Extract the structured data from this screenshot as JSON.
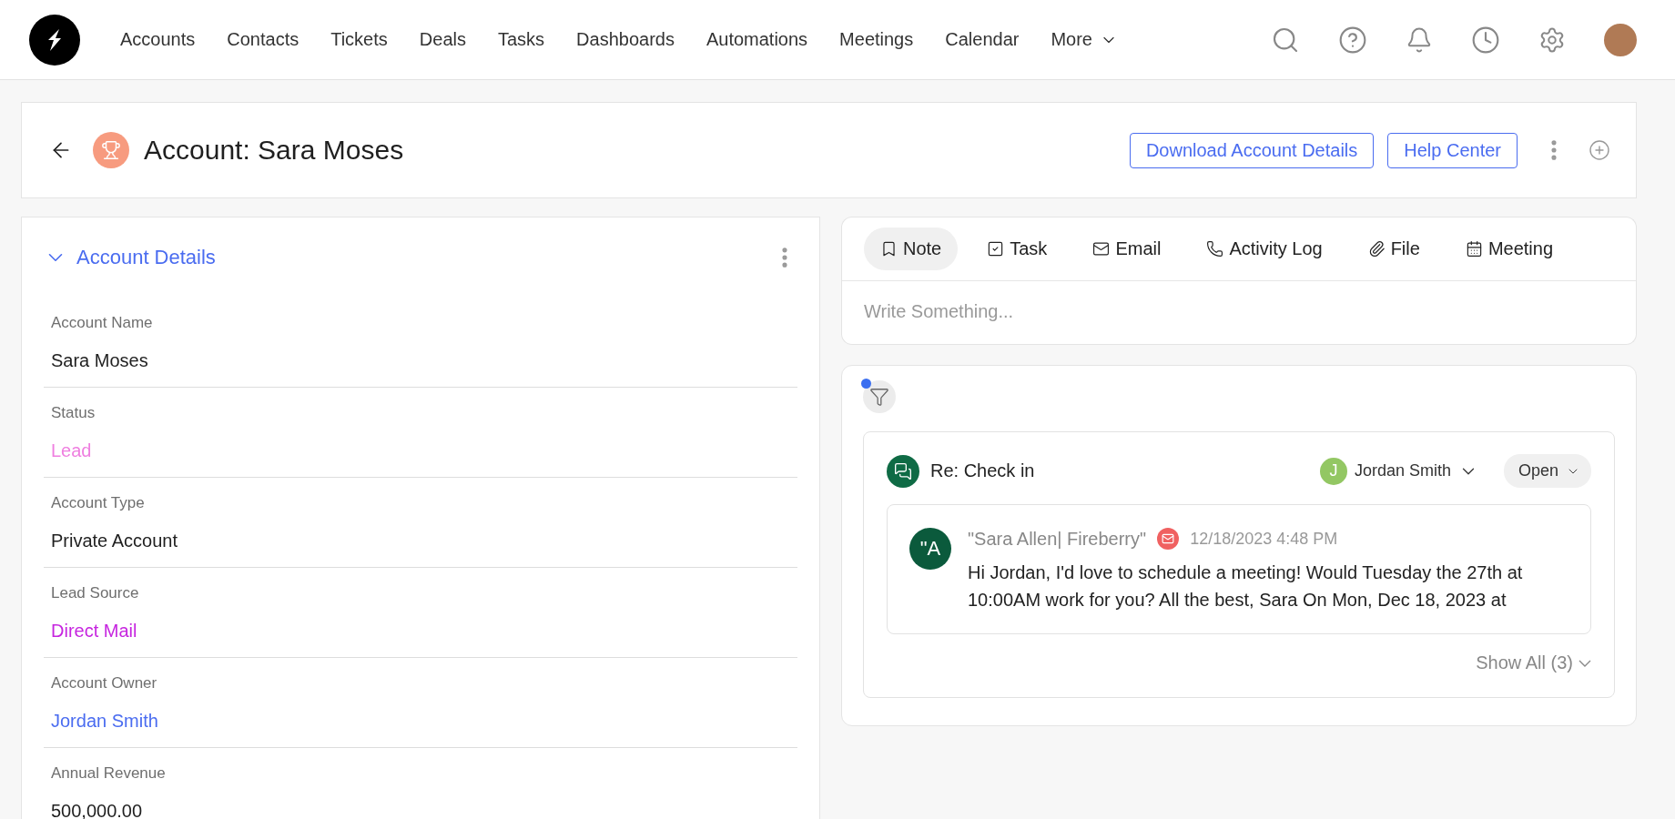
{
  "nav": {
    "items": [
      {
        "label": "Accounts"
      },
      {
        "label": "Contacts"
      },
      {
        "label": "Tickets"
      },
      {
        "label": "Deals"
      },
      {
        "label": "Tasks"
      },
      {
        "label": "Dashboards"
      },
      {
        "label": "Automations"
      },
      {
        "label": "Meetings"
      },
      {
        "label": "Calendar"
      }
    ],
    "more": "More"
  },
  "header": {
    "title": "Account: Sara Moses",
    "buttons": [
      "Download Account Details",
      "Help Center"
    ]
  },
  "details": {
    "title": "Account Details",
    "expanded": true,
    "fields": [
      {
        "label": "Account Name",
        "value": "Sara Moses",
        "color": "#1f1f1f"
      },
      {
        "label": "Status",
        "value": "Lead",
        "color": "#ef7fe0"
      },
      {
        "label": "Account Type",
        "value": "Private Account",
        "color": "#1f1f1f"
      },
      {
        "label": "Lead Source",
        "value": "Direct Mail",
        "color": "#c625df"
      },
      {
        "label": "Account Owner",
        "value": "Jordan Smith",
        "color": "#4a6cf0"
      },
      {
        "label": "Annual Revenue",
        "value": "500,000.00",
        "color": "#1f1f1f"
      }
    ]
  },
  "composer": {
    "tabs": [
      {
        "label": "Note",
        "kind": "note",
        "selected": true
      },
      {
        "label": "Task",
        "kind": "task",
        "selected": false
      },
      {
        "label": "Email",
        "kind": "email",
        "selected": false
      },
      {
        "label": "Activity Log",
        "kind": "call",
        "selected": false
      },
      {
        "label": "File",
        "kind": "file",
        "selected": false
      },
      {
        "label": "Meeting",
        "kind": "meeting",
        "selected": false
      }
    ],
    "placeholder": "Write Something..."
  },
  "activity": {
    "filter_active": true,
    "thread": {
      "subject": "Re: Check in",
      "assignee_initial": "J",
      "assignee": "Jordan Smith",
      "status": "Open",
      "message": {
        "avatar": "\"A",
        "sender": "\"Sara Allen| Fireberry\"",
        "time": "12/18/2023 4:48 PM",
        "body": "Hi Jordan, I'd love to schedule a meeting! Would Tuesday the 27th at 10:00AM work for you? All the best, Sara On Mon, Dec 18, 2023 at"
      },
      "show_all": "Show All (3)"
    }
  }
}
